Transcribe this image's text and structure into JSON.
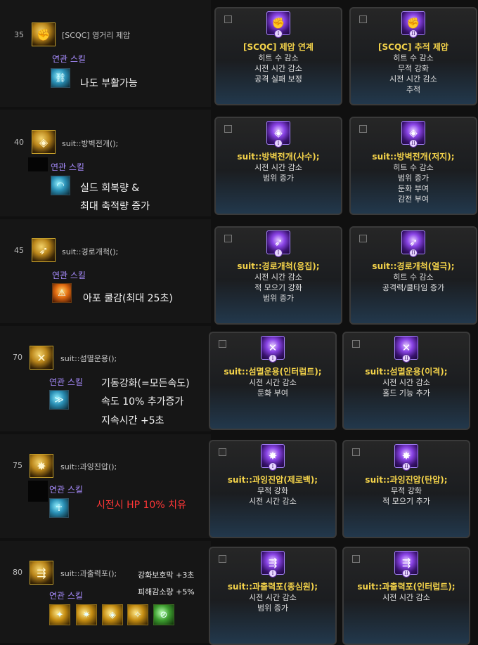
{
  "related_label": "연관 스킬",
  "rows": [
    {
      "level": "35",
      "skill": "[SCQC] 영거리 제압",
      "skill_icon": "grapple-icon",
      "related_icons": [
        "chain-icon"
      ],
      "notes": [
        "나도 부활가능"
      ],
      "cards": [
        {
          "numeral": "I",
          "title": "[SCQC] 제압 연계",
          "lines": [
            "히트 수 감소",
            "시전 시간 감소",
            "공격 실패 보정"
          ]
        },
        {
          "numeral": "II",
          "title": "[SCQC] 추적 제압",
          "lines": [
            "히트 수 감소",
            "무적 강화",
            "시전 시간 감소",
            "추적"
          ]
        }
      ]
    },
    {
      "level": "40",
      "skill": "suit::방벽전개();",
      "skill_icon": "barrier-icon",
      "related_icons": [
        "shield-wave-icon"
      ],
      "notes": [
        "실드 회복량 &",
        "최대 축적량 증가"
      ],
      "cards": [
        {
          "numeral": "I",
          "title": "suit::방벽전개(사수);",
          "lines": [
            "시전 시간 감소",
            "범위 증가"
          ]
        },
        {
          "numeral": "II",
          "title": "suit::방벽전개(저지);",
          "lines": [
            "히트 수 감소",
            "범위 증가",
            "둔화 부여",
            "감전 부여"
          ]
        }
      ]
    },
    {
      "level": "45",
      "skill": "suit::경로개척();",
      "skill_icon": "pathfinder-icon",
      "related_icons": [
        "warning-icon"
      ],
      "notes": [
        "아포 쿨감(최대 25초)"
      ],
      "cards": [
        {
          "numeral": "I",
          "title": "suit::경로개척(응집);",
          "lines": [
            "시전 시간 감소",
            "적 모으기 강화",
            "범위 증가"
          ]
        },
        {
          "numeral": "II",
          "title": "suit::경로개척(열극);",
          "lines": [
            "히트 수 감소",
            "공격력/쿨타임 증가"
          ]
        }
      ]
    },
    {
      "level": "70",
      "skill": "suit::섬멸운용();",
      "skill_icon": "annihilate-icon",
      "related_icons": [
        "dash-icon"
      ],
      "notes": [
        "기동강화(=모든속도)",
        "속도 10% 추가증가",
        "지속시간 +5초"
      ],
      "cards": [
        {
          "numeral": "I",
          "title": "suit::섬멸운용(인터럽트);",
          "lines": [
            "시전 시간 감소",
            "둔화 부여"
          ]
        },
        {
          "numeral": "II",
          "title": "suit::섬멸운용(이격);",
          "lines": [
            "시전 시간 감소",
            "홀드 기능 추가"
          ]
        }
      ]
    },
    {
      "level": "75",
      "skill": "suit::과잉진압();",
      "skill_icon": "overpower-icon",
      "related_icons": [
        "body-heal-icon"
      ],
      "notes": [
        "시전시 HP 10% 치유"
      ],
      "cards": [
        {
          "numeral": "I",
          "title": "suit::과잉진압(제로백);",
          "lines": [
            "무적 강화",
            "시전 시간 감소"
          ]
        },
        {
          "numeral": "II",
          "title": "suit::과잉진압(탄압);",
          "lines": [
            "무적 강화",
            "적 모으기 추가"
          ]
        }
      ]
    },
    {
      "level": "80",
      "skill": "suit::과출력포();",
      "skill_icon": "overload-cannon-icon",
      "related_icons": [
        "kick-icon",
        "burst-icon",
        "barrier-small-icon",
        "runner-icon",
        "cancel-icon"
      ],
      "notes": [
        "강화보호막 +3초",
        "피해감소량 +5%"
      ],
      "cards": [
        {
          "numeral": "I",
          "title": "suit::과출력포(종심원);",
          "lines": [
            "시전 시간 감소",
            "범위 증가"
          ]
        },
        {
          "numeral": "II",
          "title": "suit::과출력포(인터럽트);",
          "lines": [
            "시전 시간 감소"
          ]
        }
      ]
    }
  ]
}
